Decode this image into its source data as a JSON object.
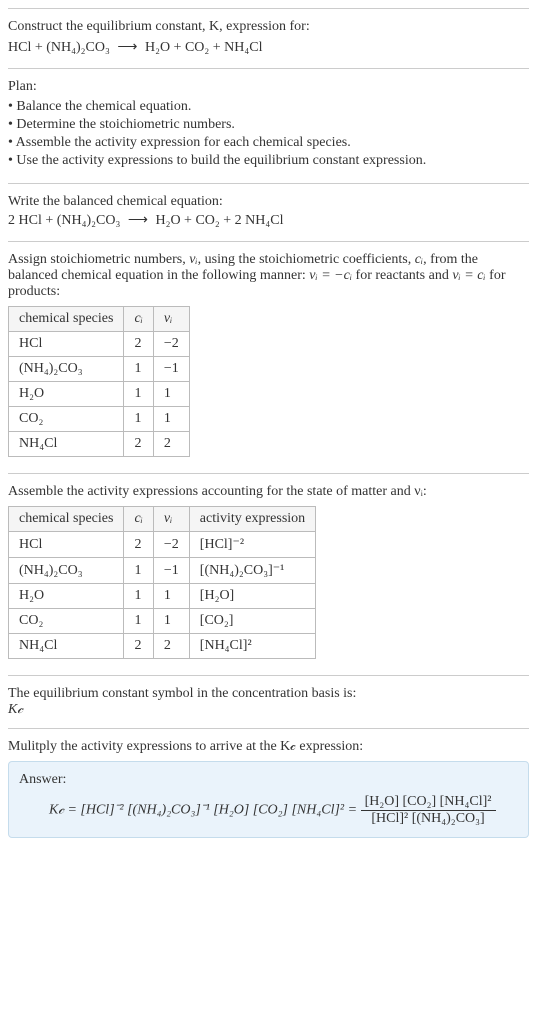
{
  "intro": {
    "line1": "Construct the equilibrium constant, K, expression for:",
    "eq_left": "HCl + (NH₄)₂CO₃",
    "arrow": "⟶",
    "eq_right": "H₂O + CO₂ + NH₄Cl"
  },
  "plan": {
    "title": "Plan:",
    "items": [
      "• Balance the chemical equation.",
      "• Determine the stoichiometric numbers.",
      "• Assemble the activity expression for each chemical species.",
      "• Use the activity expressions to build the equilibrium constant expression."
    ]
  },
  "balanced": {
    "title": "Write the balanced chemical equation:",
    "eq_left": "2 HCl + (NH₄)₂CO₃",
    "arrow": "⟶",
    "eq_right": "H₂O + CO₂ + 2 NH₄Cl"
  },
  "stoich": {
    "desc_part1": "Assign stoichiometric numbers, ",
    "desc_part2": ", using the stoichiometric coefficients, ",
    "desc_part3": ", from the balanced chemical equation in the following manner: ",
    "desc_part4": " for reactants and ",
    "desc_part5": " for products:",
    "nu_i": "νᵢ",
    "c_i": "cᵢ",
    "eq_reactants": "νᵢ = −cᵢ",
    "eq_products": "νᵢ = cᵢ",
    "headers": [
      "chemical species",
      "cᵢ",
      "νᵢ"
    ],
    "rows": [
      {
        "species": "HCl",
        "c": "2",
        "nu": "−2"
      },
      {
        "species": "(NH₄)₂CO₃",
        "c": "1",
        "nu": "−1"
      },
      {
        "species": "H₂O",
        "c": "1",
        "nu": "1"
      },
      {
        "species": "CO₂",
        "c": "1",
        "nu": "1"
      },
      {
        "species": "NH₄Cl",
        "c": "2",
        "nu": "2"
      }
    ]
  },
  "activity": {
    "desc": "Assemble the activity expressions accounting for the state of matter and νᵢ:",
    "headers": [
      "chemical species",
      "cᵢ",
      "νᵢ",
      "activity expression"
    ],
    "rows": [
      {
        "species": "HCl",
        "c": "2",
        "nu": "−2",
        "expr": "[HCl]⁻²"
      },
      {
        "species": "(NH₄)₂CO₃",
        "c": "1",
        "nu": "−1",
        "expr": "[(NH₄)₂CO₃]⁻¹"
      },
      {
        "species": "H₂O",
        "c": "1",
        "nu": "1",
        "expr": "[H₂O]"
      },
      {
        "species": "CO₂",
        "c": "1",
        "nu": "1",
        "expr": "[CO₂]"
      },
      {
        "species": "NH₄Cl",
        "c": "2",
        "nu": "2",
        "expr": "[NH₄Cl]²"
      }
    ]
  },
  "symbol": {
    "line1": "The equilibrium constant symbol in the concentration basis is:",
    "kc": "K𝒸"
  },
  "final": {
    "desc": "Mulitply the activity expressions to arrive at the K𝒸 expression:",
    "answer_label": "Answer:",
    "kc_eq": "K𝒸 = [HCl]⁻² [(NH₄)₂CO₃]⁻¹ [H₂O] [CO₂] [NH₄Cl]² = ",
    "frac_num": "[H₂O] [CO₂] [NH₄Cl]²",
    "frac_den": "[HCl]² [(NH₄)₂CO₃]"
  },
  "chart_data": {
    "type": "table",
    "tables": [
      {
        "title": "Stoichiometric numbers",
        "headers": [
          "chemical species",
          "c_i",
          "nu_i"
        ],
        "rows": [
          [
            "HCl",
            2,
            -2
          ],
          [
            "(NH4)2CO3",
            1,
            -1
          ],
          [
            "H2O",
            1,
            1
          ],
          [
            "CO2",
            1,
            1
          ],
          [
            "NH4Cl",
            2,
            2
          ]
        ]
      },
      {
        "title": "Activity expressions",
        "headers": [
          "chemical species",
          "c_i",
          "nu_i",
          "activity expression"
        ],
        "rows": [
          [
            "HCl",
            2,
            -2,
            "[HCl]^-2"
          ],
          [
            "(NH4)2CO3",
            1,
            -1,
            "[(NH4)2CO3]^-1"
          ],
          [
            "H2O",
            1,
            1,
            "[H2O]"
          ],
          [
            "CO2",
            1,
            1,
            "[CO2]"
          ],
          [
            "NH4Cl",
            2,
            2,
            "[NH4Cl]^2"
          ]
        ]
      }
    ]
  }
}
